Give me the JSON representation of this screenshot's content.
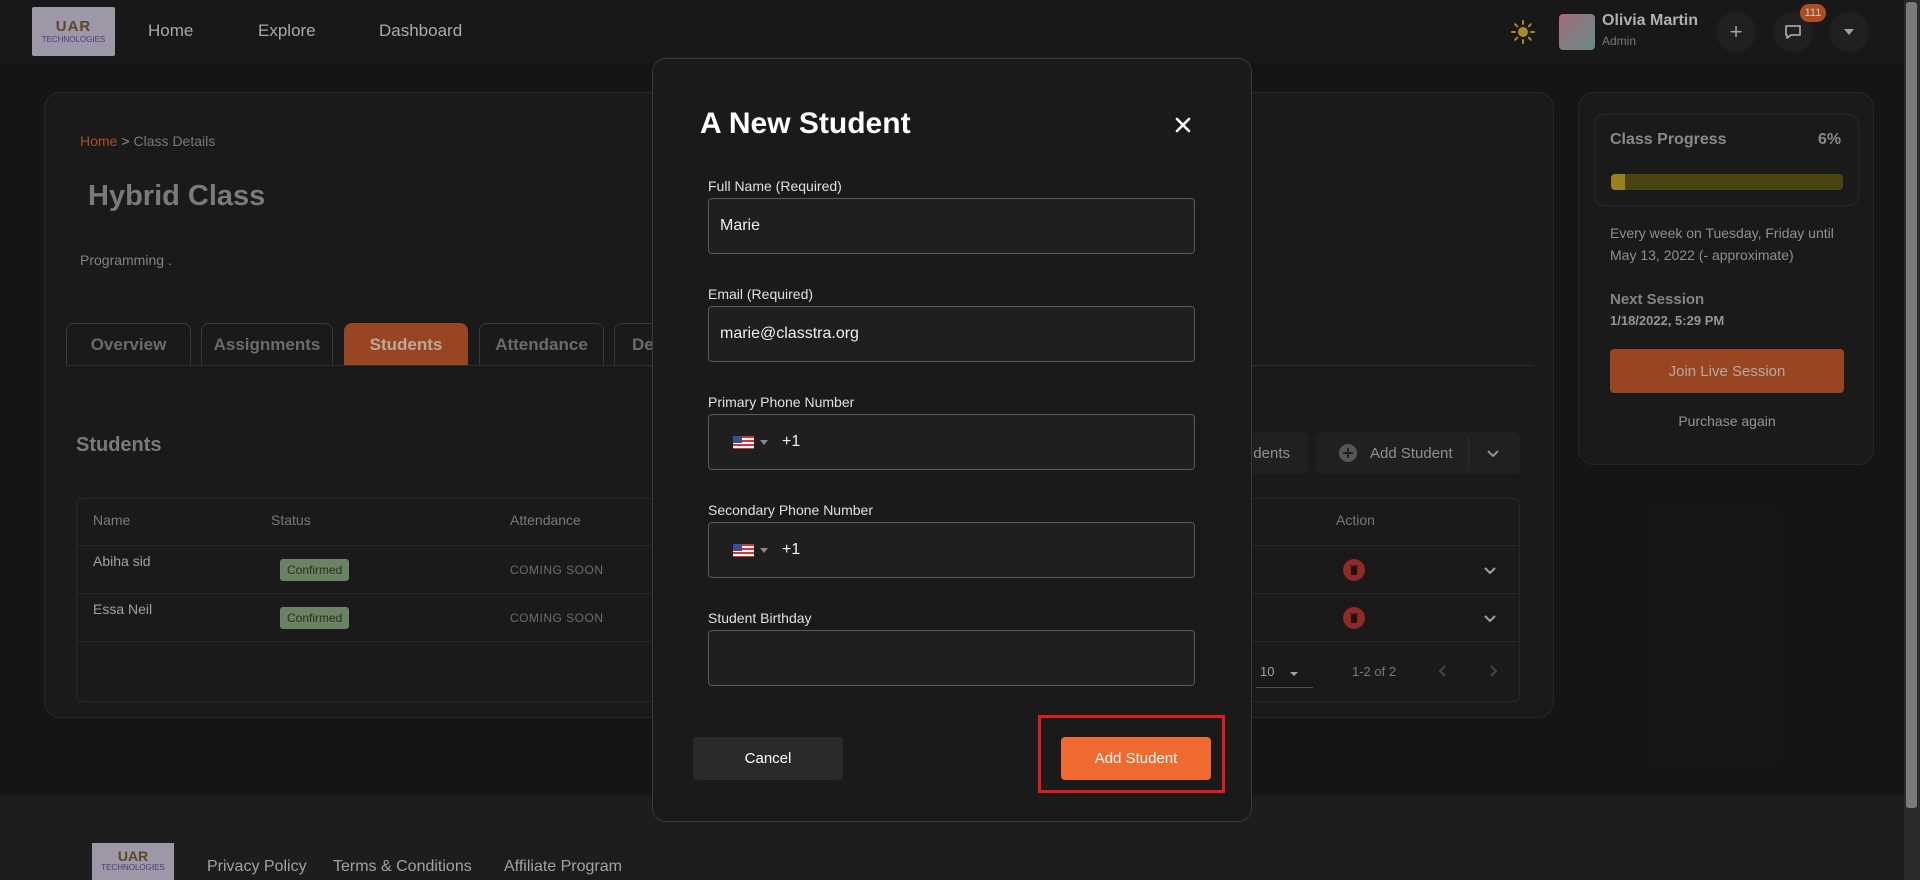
{
  "nav": {
    "logo_line1": "UAR",
    "logo_line2": "TECHNOLOGIES",
    "links": [
      "Home",
      "Explore",
      "Dashboard"
    ],
    "user_name": "Olivia Martin",
    "user_role": "Admin",
    "notification_count": "111"
  },
  "breadcrumb": {
    "home": "Home",
    "separator": ">",
    "current": "Class Details"
  },
  "class": {
    "title": "Hybrid Class",
    "category": "Programming ."
  },
  "tabs": [
    "Overview",
    "Assignments",
    "Students",
    "Attendance",
    "De"
  ],
  "students": {
    "title": "Students",
    "partial_button": "dents",
    "add_button": "Add Student",
    "columns": {
      "name": "Name",
      "status": "Status",
      "attendance": "Attendance",
      "action": "Action"
    },
    "rows": [
      {
        "name": "Abiha sid",
        "status": "Confirmed",
        "attendance": "COMING SOON"
      },
      {
        "name": "Essa Neil",
        "status": "Confirmed",
        "attendance": "COMING SOON"
      }
    ],
    "rows_per_page": "10",
    "range": "1-2 of 2"
  },
  "side": {
    "progress_label": "Class Progress",
    "progress_pct_text": "6%",
    "progress_value": 0.06,
    "schedule": "Every week on Tuesday, Friday until May 13, 2022 (- approximate)",
    "next_label": "Next Session",
    "next_time": "1/18/2022, 5:29 PM",
    "join_button": "Join Live Session",
    "purchase": "Purchase again"
  },
  "footer": {
    "logo_line1": "UAR",
    "logo_line2": "TECHNOLOGIES",
    "links": [
      "Privacy Policy",
      "Terms & Conditions",
      "Affiliate Program"
    ]
  },
  "modal": {
    "title": "A New Student",
    "full_name_label": "Full Name (Required)",
    "full_name_value": "Marie",
    "email_label": "Email (Required)",
    "email_value": "marie@classtra.org",
    "primary_phone_label": "Primary Phone Number",
    "primary_phone_code": "+1",
    "secondary_phone_label": "Secondary Phone Number",
    "secondary_phone_code": "+1",
    "birthday_label": "Student Birthday",
    "birthday_value": "",
    "cancel": "Cancel",
    "submit": "Add Student"
  },
  "colors": {
    "accent": "#f0692e",
    "tab_active": "#c35a2c",
    "confirmed": "#88a880",
    "danger": "#b8362f",
    "highlight": "#e01b24"
  }
}
